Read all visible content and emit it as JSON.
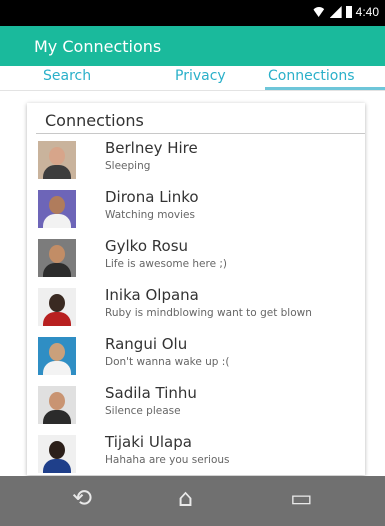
{
  "status_bar": {
    "time": "4:40",
    "wifi_icon": "wifi-icon",
    "signal_icon": "signal-icon",
    "battery_icon": "battery-icon"
  },
  "app_bar": {
    "title": "My Connections"
  },
  "tabs": [
    {
      "label": "Search",
      "selected": false
    },
    {
      "label": "Privacy",
      "selected": false
    },
    {
      "label": "Connections",
      "selected": true
    }
  ],
  "card": {
    "title": "Connections"
  },
  "connections": [
    {
      "name": "Berlney Hire",
      "status": "Sleeping",
      "avatar_colors": {
        "bg": "#c9b39c",
        "head": "#d7a58a",
        "body": "#3d3d3d"
      }
    },
    {
      "name": "Dirona Linko",
      "status": "Watching movies",
      "avatar_colors": {
        "bg": "#6d65b8",
        "head": "#b07c5c",
        "body": "#f2f2f2"
      }
    },
    {
      "name": "Gylko Rosu",
      "status": "Life is awesome here ;)",
      "avatar_colors": {
        "bg": "#7c7c7c",
        "head": "#c28d66",
        "body": "#2c2c2c"
      }
    },
    {
      "name": "Inika Olpana",
      "status": "Ruby is mindblowing want to get blown",
      "avatar_colors": {
        "bg": "#efefef",
        "head": "#3a2a22",
        "body": "#b82020"
      }
    },
    {
      "name": "Rangui Olu",
      "status": "Don't wanna wake up :(",
      "avatar_colors": {
        "bg": "#2f8ec4",
        "head": "#caa07b",
        "body": "#f3f3f3"
      }
    },
    {
      "name": "Sadila Tinhu",
      "status": "Silence please",
      "avatar_colors": {
        "bg": "#e0e0e0",
        "head": "#c99472",
        "body": "#2b2b2b"
      }
    },
    {
      "name": "Tijaki Ulapa",
      "status": "Hahaha are you serious",
      "avatar_colors": {
        "bg": "#f0f0f0",
        "head": "#2c201a",
        "body": "#1f3f8a"
      }
    }
  ],
  "nav": {
    "back_icon": "back-icon",
    "home_icon": "home-icon",
    "recent_icon": "recent-apps-icon"
  },
  "colors": {
    "primary": "#1aba9c",
    "tab_text": "#2ab0c9",
    "tab_indicator": "#6ec6d9",
    "nav_bar": "#707070"
  }
}
